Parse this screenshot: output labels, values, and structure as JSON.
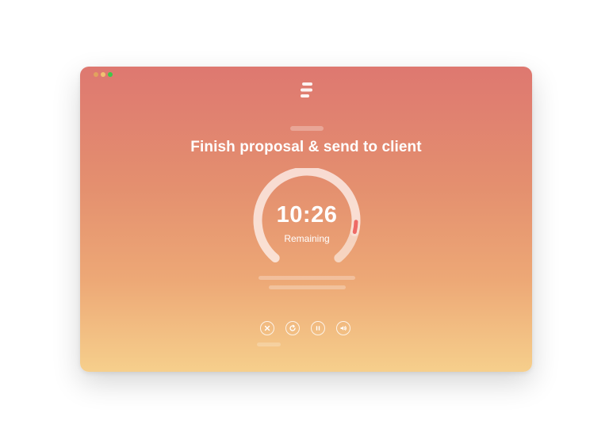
{
  "window": {
    "traffic_lights": [
      "close",
      "minimize",
      "zoom"
    ]
  },
  "app": {
    "logo_icon": "stacked-lines-logo"
  },
  "task": {
    "title": "Finish proposal & send to client"
  },
  "timer": {
    "time": "10:26",
    "label": "Remaining",
    "progress_fraction": 0.87
  },
  "controls": [
    {
      "icon": "close-icon"
    },
    {
      "icon": "reset-icon"
    },
    {
      "icon": "pause-icon"
    },
    {
      "icon": "volume-icon"
    }
  ],
  "colors": {
    "gradient_top": "#de7870",
    "gradient_bottom": "#f6cf8c",
    "ring_track": "#f2d0c4",
    "ring_progress": "#ee6a66",
    "text": "#ffffff"
  }
}
